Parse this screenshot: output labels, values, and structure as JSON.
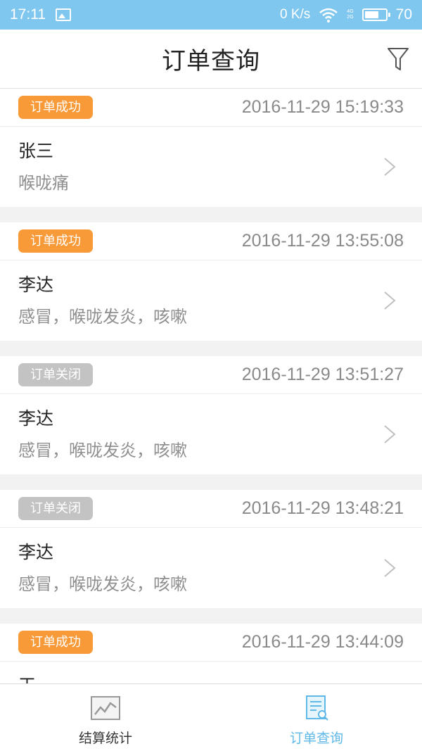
{
  "status_bar": {
    "time": "17:11",
    "speed": "0 K/s",
    "network_top": "4G",
    "network_bottom": "2G",
    "battery": "70",
    "battery_level": 0.7
  },
  "header": {
    "title": "订单查询",
    "filter_icon": "filter-icon"
  },
  "orders": [
    {
      "status": "订单成功",
      "status_type": "success",
      "time": "2016-11-29 15:19:33",
      "name": "张三",
      "desc": "喉咙痛"
    },
    {
      "status": "订单成功",
      "status_type": "success",
      "time": "2016-11-29 13:55:08",
      "name": "李达",
      "desc": "感冒，喉咙发炎，咳嗽"
    },
    {
      "status": "订单关闭",
      "status_type": "closed",
      "time": "2016-11-29 13:51:27",
      "name": "李达",
      "desc": "感冒，喉咙发炎，咳嗽"
    },
    {
      "status": "订单关闭",
      "status_type": "closed",
      "time": "2016-11-29 13:48:21",
      "name": "李达",
      "desc": "感冒，喉咙发炎，咳嗽"
    },
    {
      "status": "订单成功",
      "status_type": "success",
      "time": "2016-11-29 13:44:09",
      "name": "王",
      "desc": ""
    }
  ],
  "tabbar": {
    "tabs": [
      {
        "label": "结算统计",
        "icon": "chart-icon",
        "active": false
      },
      {
        "label": "订单查询",
        "icon": "document-search-icon",
        "active": true
      }
    ]
  },
  "colors": {
    "status_bar": "#7fc7ee",
    "success": "#f99a39",
    "closed": "#c3c3c3",
    "active_tab": "#5eb8e8"
  }
}
